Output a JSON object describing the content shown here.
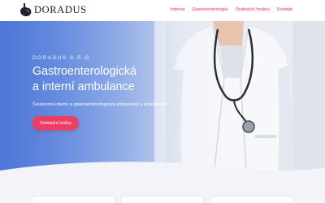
{
  "brand": {
    "name": "DORADUS",
    "logo_icon": "stomach-logo-icon"
  },
  "nav": {
    "items": [
      {
        "label": "Interna"
      },
      {
        "label": "Gastroenterologie"
      },
      {
        "label": "Ordinační hodiny"
      },
      {
        "label": "Kontakt"
      }
    ]
  },
  "hero": {
    "kicker": "DORADUS S.R.O.",
    "title_line1": "Gastroenterologická",
    "title_line2": "a interní ambulance",
    "subtitle": "Soukromá interní a gastroenterologická ambulance s endoskopií",
    "cta_label": "Ordinační hodiny"
  },
  "colors": {
    "accent": "#ee3d63",
    "hero_blue": "#5d86e0",
    "section_bg": "#f3f4fa"
  }
}
